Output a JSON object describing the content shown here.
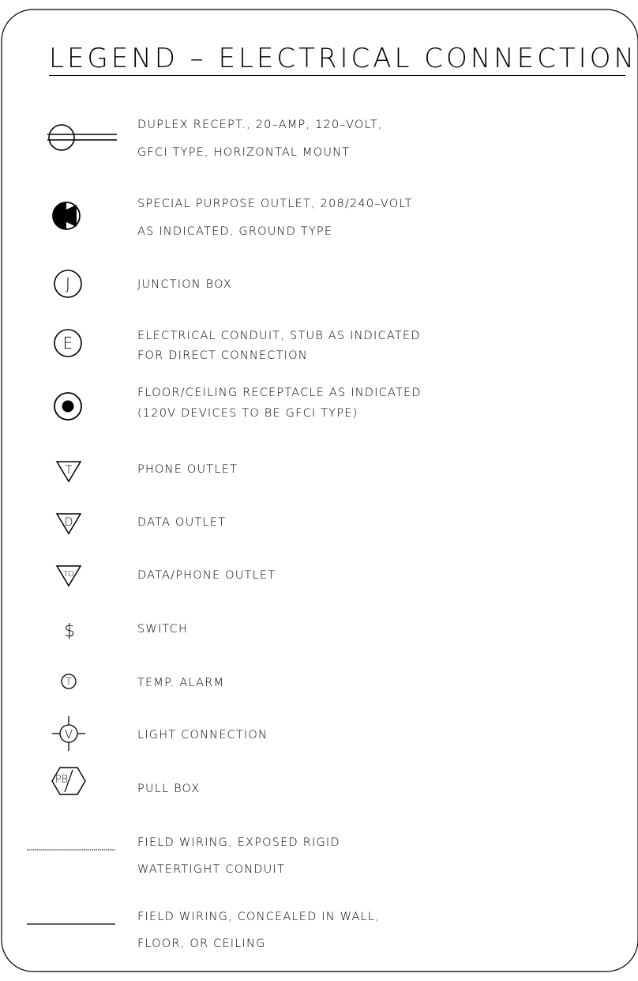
{
  "title": "LEGEND – ELECTRICAL CONNECTIONS",
  "entries": [
    {
      "symbol": "duplex-receptacle-icon",
      "lines": [
        "DUPLEX RECEPT., 20–AMP, 120–VOLT,",
        "GFCI TYPE, HORIZONTAL MOUNT"
      ]
    },
    {
      "symbol": "special-purpose-outlet-icon",
      "lines": [
        "SPECIAL PURPOSE OUTLET, 208/240–VOLT",
        "AS INDICATED, GROUND TYPE"
      ]
    },
    {
      "symbol": "junction-box-icon",
      "glyph": "J",
      "lines": [
        "JUNCTION BOX"
      ]
    },
    {
      "symbol": "electrical-conduit-icon",
      "glyph": "E",
      "lines": [
        "ELECTRICAL CONDUIT, STUB AS INDICATED",
        "FOR DIRECT CONNECTION"
      ]
    },
    {
      "symbol": "floor-ceiling-receptacle-icon",
      "lines": [
        "FLOOR/CEILING RECEPTACLE AS INDICATED",
        "(120V DEVICES TO BE GFCI TYPE)"
      ]
    },
    {
      "symbol": "phone-outlet-icon",
      "glyph": "T",
      "lines": [
        "PHONE OUTLET"
      ]
    },
    {
      "symbol": "data-outlet-icon",
      "glyph": "D",
      "lines": [
        "DATA OUTLET"
      ]
    },
    {
      "symbol": "data-phone-outlet-icon",
      "glyph": "TD",
      "lines": [
        "DATA/PHONE OUTLET"
      ]
    },
    {
      "symbol": "switch-icon",
      "glyph": "$",
      "lines": [
        "SWITCH"
      ]
    },
    {
      "symbol": "temp-alarm-icon",
      "glyph": "T",
      "lines": [
        "TEMP. ALARM"
      ]
    },
    {
      "symbol": "light-connection-icon",
      "glyph": "V",
      "lines": [
        "LIGHT CONNECTION"
      ]
    },
    {
      "symbol": "pull-box-icon",
      "glyph": "PB",
      "lines": [
        "PULL BOX"
      ]
    },
    {
      "symbol": "exposed-wiring-line-icon",
      "lines": [
        "FIELD WIRING, EXPOSED RIGID",
        "WATERTIGHT CONDUIT"
      ]
    },
    {
      "symbol": "concealed-wiring-line-icon",
      "lines": [
        "FIELD WIRING, CONCEALED IN WALL,",
        "FLOOR, OR CEILING"
      ]
    }
  ]
}
